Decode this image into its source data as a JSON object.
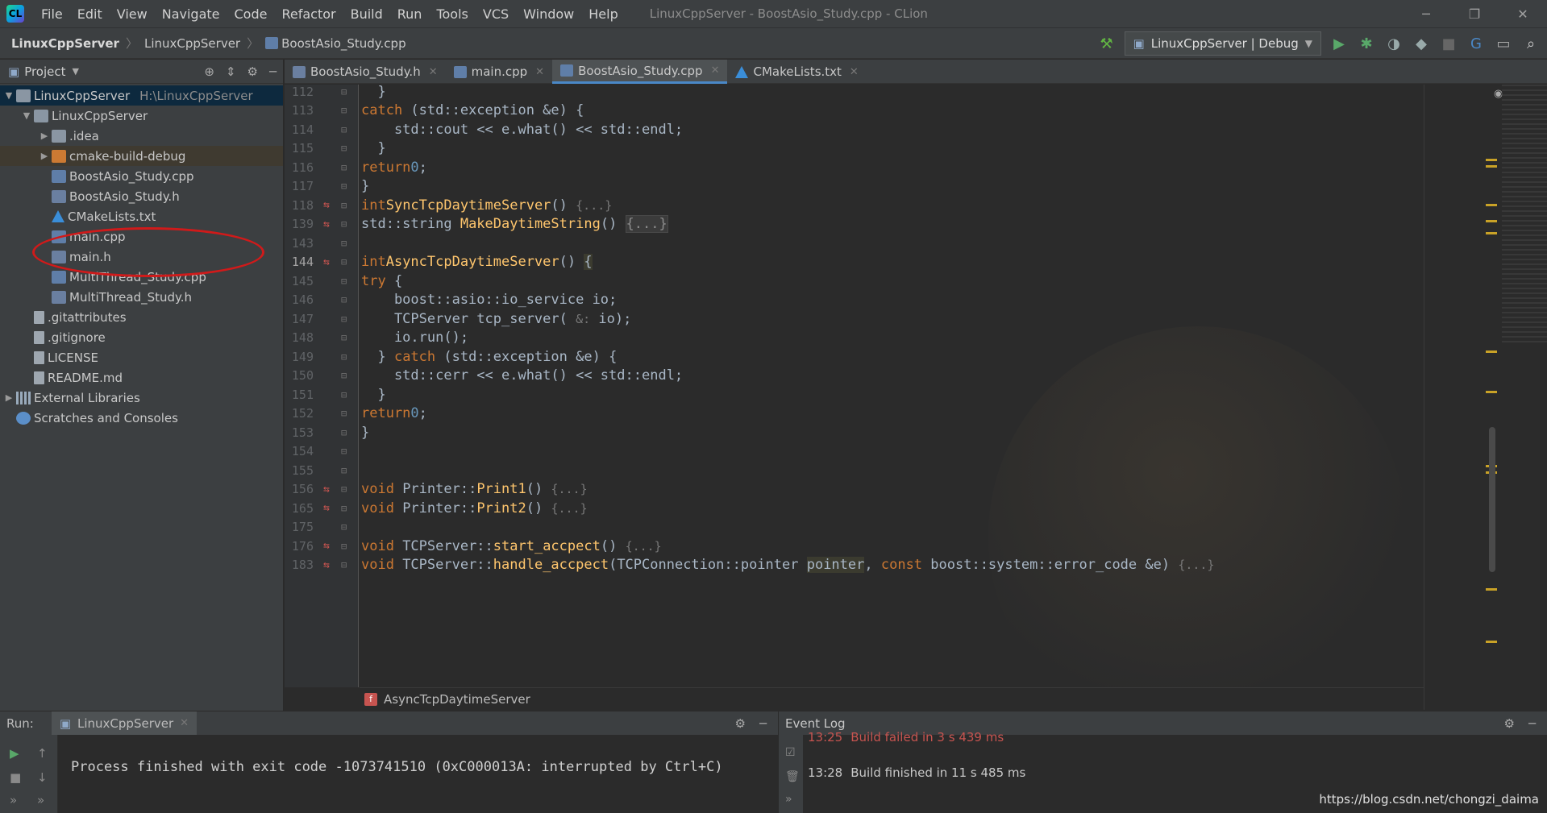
{
  "window": {
    "menu": [
      "File",
      "Edit",
      "View",
      "Navigate",
      "Code",
      "Refactor",
      "Build",
      "Run",
      "Tools",
      "VCS",
      "Window",
      "Help"
    ],
    "title": "LinuxCppServer - BoostAsio_Study.cpp - CLion"
  },
  "navbar": {
    "crumbs": [
      "LinuxCppServer",
      "LinuxCppServer",
      "BoostAsio_Study.cpp"
    ],
    "run_config": "LinuxCppServer | Debug"
  },
  "project": {
    "title": "Project",
    "tree": [
      {
        "label": "LinuxCppServer",
        "hint": "H:\\LinuxCppServer",
        "level": 0,
        "arrow": "▼",
        "icon": "folder",
        "selected": true
      },
      {
        "label": "LinuxCppServer",
        "level": 1,
        "arrow": "▼",
        "icon": "folder"
      },
      {
        "label": ".idea",
        "level": 2,
        "arrow": "▶",
        "icon": "folder"
      },
      {
        "label": "cmake-build-debug",
        "level": 2,
        "arrow": "▶",
        "icon": "folder-o",
        "highlight": true
      },
      {
        "label": "BoostAsio_Study.cpp",
        "level": 2,
        "icon": "cpp"
      },
      {
        "label": "BoostAsio_Study.h",
        "level": 2,
        "icon": "h"
      },
      {
        "label": "CMakeLists.txt",
        "level": 2,
        "icon": "cmake"
      },
      {
        "label": "main.cpp",
        "level": 2,
        "icon": "cpp"
      },
      {
        "label": "main.h",
        "level": 2,
        "icon": "h"
      },
      {
        "label": "MultiThread_Study.cpp",
        "level": 2,
        "icon": "cpp"
      },
      {
        "label": "MultiThread_Study.h",
        "level": 2,
        "icon": "h"
      },
      {
        "label": ".gitattributes",
        "level": 1,
        "icon": "file"
      },
      {
        "label": ".gitignore",
        "level": 1,
        "icon": "file"
      },
      {
        "label": "LICENSE",
        "level": 1,
        "icon": "file"
      },
      {
        "label": "README.md",
        "level": 1,
        "icon": "file"
      },
      {
        "label": "External Libraries",
        "level": 0,
        "arrow": "▶",
        "icon": "lib"
      },
      {
        "label": "Scratches and Consoles",
        "level": 0,
        "icon": "scratch"
      }
    ]
  },
  "tabs": [
    {
      "label": "BoostAsio_Study.h",
      "active": false
    },
    {
      "label": "main.cpp",
      "active": false
    },
    {
      "label": "BoostAsio_Study.cpp",
      "active": true
    },
    {
      "label": "CMakeLists.txt",
      "active": false
    }
  ],
  "code": [
    {
      "n": "112",
      "html": "  }"
    },
    {
      "n": "113",
      "html": "  <span class='kw'>catch</span> (std::exception &amp;e) {"
    },
    {
      "n": "114",
      "html": "    std::cout &lt;&lt; e.what() &lt;&lt; std::endl;"
    },
    {
      "n": "115",
      "html": "  }"
    },
    {
      "n": "116",
      "html": "  <span class='kw'>return</span> <span class='num2'>0</span>;"
    },
    {
      "n": "117",
      "html": "}"
    },
    {
      "n": "118",
      "mark": true,
      "html": "<span class='kw'>int</span> <span class='fn'>SyncTcpDaytimeServer</span>() <span class='hint2'>{...}</span>"
    },
    {
      "n": "139",
      "mark": true,
      "html": "std::string <span class='fn'>MakeDaytimeString</span>() <span class='fd'>{...}</span>"
    },
    {
      "n": "143",
      "html": ""
    },
    {
      "n": "144",
      "mark": true,
      "cur": true,
      "html": "<span class='kw'>int</span> <span class='fn'>AsyncTcpDaytimeServer</span>() <span class='hl2'>{</span>"
    },
    {
      "n": "145",
      "html": "  <span class='kw'>try</span> {"
    },
    {
      "n": "146",
      "html": "    boost::asio::io_service io;"
    },
    {
      "n": "147",
      "html": "    TCPServer tcp_server( <span class='hint2'>&amp;:</span> io);"
    },
    {
      "n": "148",
      "html": "    io.run();"
    },
    {
      "n": "149",
      "html": "  } <span class='kw'>catch</span> (std::exception &amp;e) {"
    },
    {
      "n": "150",
      "html": "    std::cerr &lt;&lt; e.what() &lt;&lt; std::endl;"
    },
    {
      "n": "151",
      "html": "  }"
    },
    {
      "n": "152",
      "html": "  <span class='kw'>return</span> <span class='num2'>0</span>;"
    },
    {
      "n": "153",
      "html": "}"
    },
    {
      "n": "154",
      "html": ""
    },
    {
      "n": "155",
      "html": ""
    },
    {
      "n": "156",
      "mark": true,
      "html": "<span class='kw'>void</span> Printer::<span class='fn'>Print1</span>() <span class='hint2'>{...}</span>"
    },
    {
      "n": "165",
      "mark": true,
      "html": "<span class='kw'>void</span> Printer::<span class='fn'>Print2</span>() <span class='hint2'>{...}</span>"
    },
    {
      "n": "175",
      "html": ""
    },
    {
      "n": "176",
      "mark": true,
      "html": "<span class='kw'>void</span> TCPServer::<span class='fn'>start_accpect</span>() <span class='hint2'>{...}</span>"
    },
    {
      "n": "183",
      "mark": true,
      "html": "<span class='kw'>void</span> TCPServer::<span class='fn'>handle_accpect</span>(TCPConnection::pointer <span class='hl2'>pointer</span>, <span class='kw'>const</span> boost::system::error_code &amp;e) <span class='hint2'>{...}</span>"
    }
  ],
  "breadcrumb": {
    "badge": "f",
    "label": "AsyncTcpDaytimeServer"
  },
  "run": {
    "label": "Run:",
    "tab": "LinuxCppServer",
    "output": "Process finished with exit code -1073741510 (0xC000013A: interrupted by Ctrl+C)"
  },
  "event_log": {
    "title": "Event Log",
    "entries": [
      {
        "time": "13:25",
        "text": "Build failed in 3 s 439 ms",
        "error": true
      },
      {
        "time": "13:28",
        "text": "Build finished in 11 s 485 ms",
        "error": false
      }
    ]
  },
  "watermark": "https://blog.csdn.net/chongzi_daima"
}
